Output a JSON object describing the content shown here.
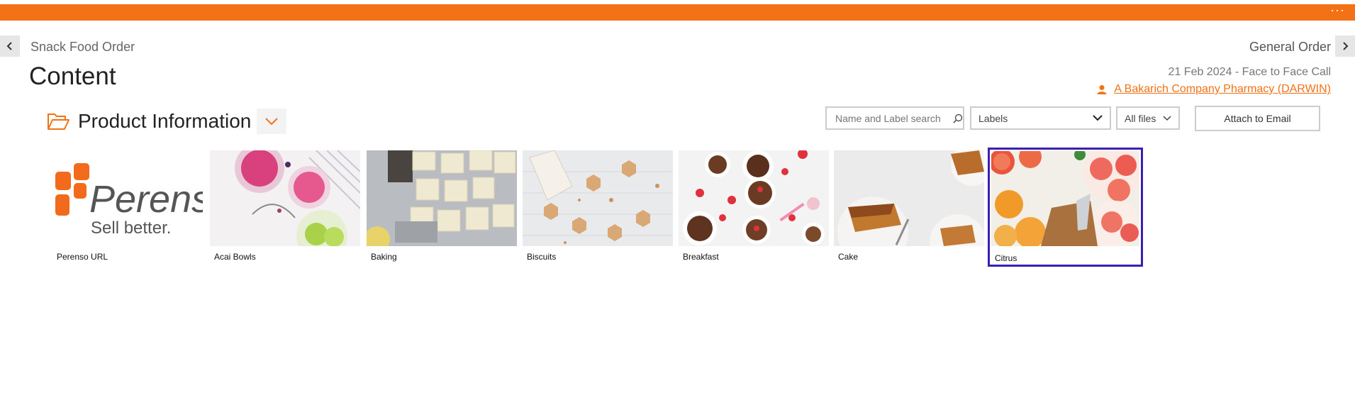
{
  "header": {
    "more_label": "···",
    "breadcrumb": "Snack Food Order",
    "order_type": "General Order",
    "page_title": "Content",
    "call_info": "21 Feb 2024  - Face to Face Call",
    "customer_link": "A Bakarich Company Pharmacy (DARWIN)"
  },
  "section": {
    "title": "Product Information"
  },
  "toolbar": {
    "search_placeholder": "Name and Label search",
    "labels_value": "Labels",
    "files_value": "All files",
    "attach_label": "Attach to Email"
  },
  "tiles": [
    {
      "caption": "Perenso URL",
      "logo_word": "Perenso",
      "logo_tagline": "Sell better."
    },
    {
      "caption": "Acai Bowls"
    },
    {
      "caption": "Baking"
    },
    {
      "caption": "Biscuits"
    },
    {
      "caption": "Breakfast"
    },
    {
      "caption": "Cake"
    },
    {
      "caption": "Citrus",
      "selected": true
    }
  ],
  "colors": {
    "accent": "#f47216",
    "selection": "#3a1fb0"
  }
}
